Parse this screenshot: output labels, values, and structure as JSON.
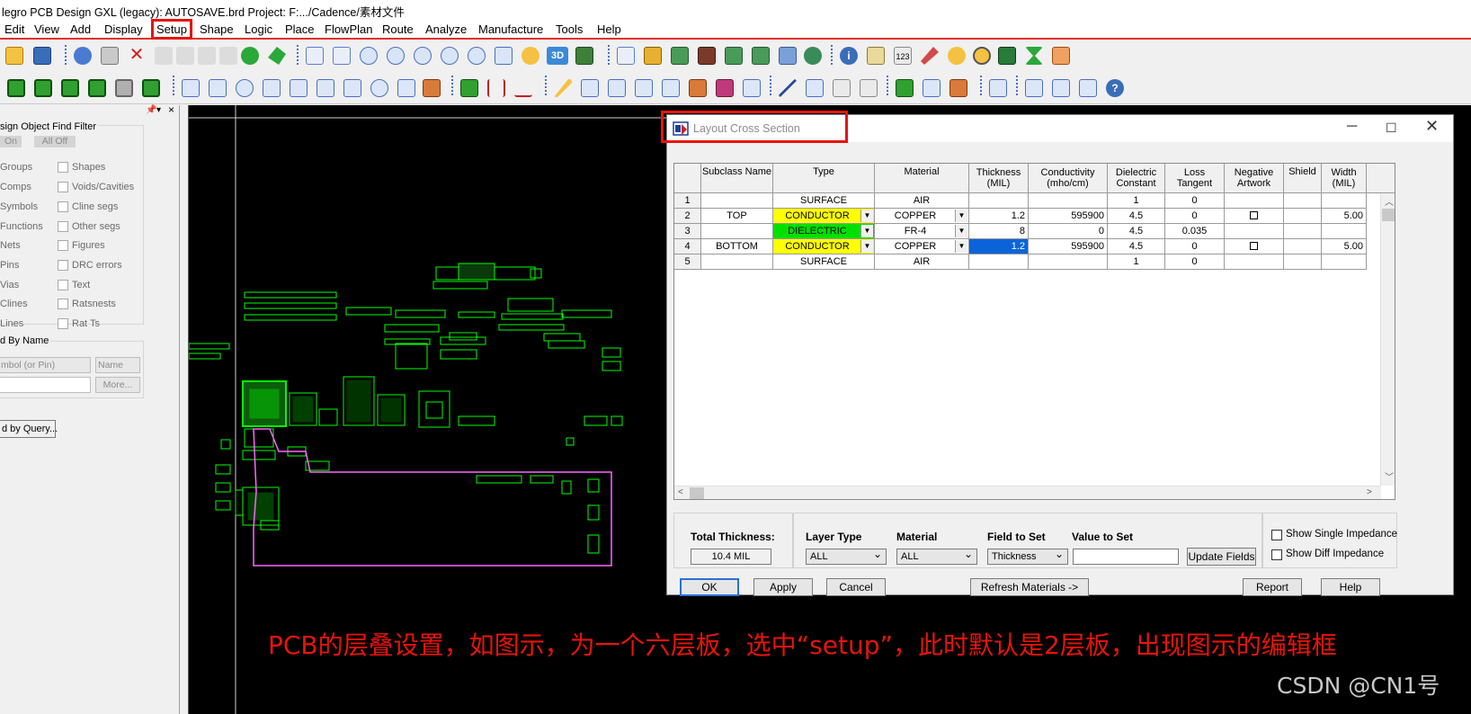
{
  "app_title": "legro PCB Design GXL (legacy): AUTOSAVE.brd  Project: F:.../Cadence/素材文件",
  "menu": [
    "Edit",
    "View",
    "Add",
    "Display",
    "Setup",
    "Shape",
    "Logic",
    "Place",
    "FlowPlan",
    "Route",
    "Analyze",
    "Manufacture",
    "Tools",
    "Help"
  ],
  "find_filter": {
    "title": "sign Object Find Filter",
    "on_label": "On",
    "all_off_label": "All Off",
    "left_items": [
      "Groups",
      "Comps",
      "Symbols",
      "Functions",
      "Nets",
      "Pins",
      "Vias",
      "Clines",
      "Lines"
    ],
    "right_items": [
      "Shapes",
      "Voids/Cavities",
      "Cline segs",
      "Other segs",
      "Figures",
      "DRC errors",
      "Text",
      "Ratsnests",
      "Rat Ts"
    ],
    "find_by_name_title": "d By Name",
    "symbol_combo": "mbol (or Pin)",
    "name_combo": "Name",
    "more_button": "More...",
    "query_button": "d by Query..."
  },
  "dialog": {
    "title": "Layout Cross Section",
    "columns": [
      "Subclass Name",
      "Type",
      "Material",
      "Thickness\n(MIL)",
      "Conductivity\n(mho/cm)",
      "Dielectric\nConstant",
      "Loss\nTangent",
      "Negative\nArtwork",
      "Shield",
      "Width\n(MIL)"
    ],
    "rows": [
      {
        "num": "1",
        "subclass": "",
        "type": "SURFACE",
        "type_color": "",
        "material": "AIR",
        "thickness": "",
        "conductivity": "",
        "dielectric": "1",
        "loss": "0",
        "negative": false,
        "width": ""
      },
      {
        "num": "2",
        "subclass": "TOP",
        "type": "CONDUCTOR",
        "type_color": "yellow",
        "material": "COPPER",
        "thickness": "1.2",
        "conductivity": "595900",
        "dielectric": "4.5",
        "loss": "0",
        "negative": true,
        "width": "5.00"
      },
      {
        "num": "3",
        "subclass": "",
        "type": "DIELECTRIC",
        "type_color": "green",
        "material": "FR-4",
        "thickness": "8",
        "conductivity": "0",
        "dielectric": "4.5",
        "loss": "0.035",
        "negative": false,
        "width": ""
      },
      {
        "num": "4",
        "subclass": "BOTTOM",
        "type": "CONDUCTOR",
        "type_color": "yellow",
        "material": "COPPER",
        "thickness": "1.2",
        "conductivity": "595900",
        "dielectric": "4.5",
        "loss": "0",
        "negative": true,
        "width": "5.00"
      },
      {
        "num": "5",
        "subclass": "",
        "type": "SURFACE",
        "type_color": "",
        "material": "AIR",
        "thickness": "",
        "conductivity": "",
        "dielectric": "1",
        "loss": "0",
        "negative": false,
        "width": ""
      }
    ],
    "total_thickness_label": "Total Thickness:",
    "total_thickness_value": "10.4 MIL",
    "layer_type_label": "Layer Type",
    "layer_type_value": "ALL",
    "material_label": "Material",
    "material_value": "ALL",
    "field_to_set_label": "Field to Set",
    "field_to_set_value": "Thickness",
    "value_to_set_label": "Value to Set",
    "value_to_set_value": "",
    "update_fields": "Update Fields",
    "show_single_impedance": "Show Single Impedance",
    "show_diff_impedance": "Show Diff Impedance",
    "ok": "OK",
    "apply": "Apply",
    "cancel": "Cancel",
    "refresh_materials": "Refresh Materials ->",
    "report": "Report",
    "help": "Help"
  },
  "caption": "PCB的层叠设置，如图示，为一个六层板，选中“setup”，此时默认是2层板，出现图示的编辑框",
  "watermark": "CSDN @CN1号",
  "colors": {
    "highlight": "#e8140a",
    "conductor": "#ffff00",
    "dielectric": "#00e000",
    "selected": "#0a64d8",
    "pcb_trace": "#00ff00",
    "pcb_outline": "#ff66ff"
  }
}
